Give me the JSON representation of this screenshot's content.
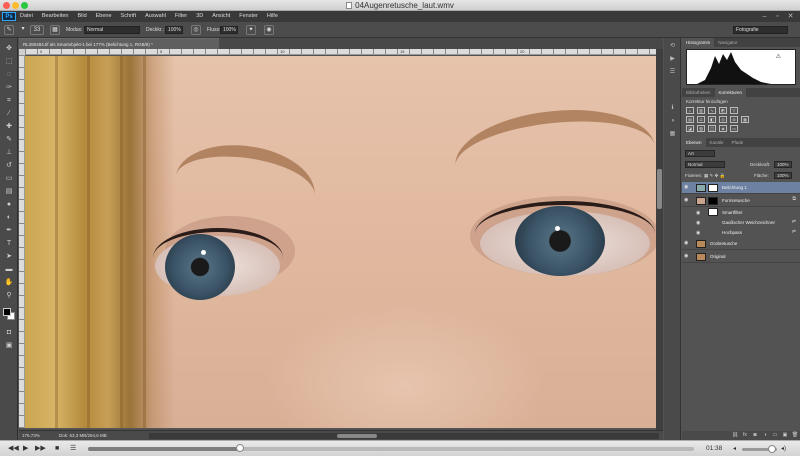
{
  "window": {
    "title": "04Augenretusche_laut.wmv"
  },
  "app": {
    "logo": "Ps",
    "menu": [
      "Datei",
      "Bearbeiten",
      "Bild",
      "Ebene",
      "Schrift",
      "Auswahl",
      "Filter",
      "3D",
      "Ansicht",
      "Fenster",
      "Hilfe"
    ]
  },
  "options": {
    "size": "33",
    "mode_label": "Modus:",
    "mode_value": "Normal",
    "opacity_label": "Deckkr.:",
    "opacity_value": "100%",
    "flow_label": "Fluss:",
    "flow_value": "100%",
    "workspace": "Fotografie"
  },
  "document": {
    "tab": "RL380484.tif als Smartobjekt-1 bei 177% (Belichtung 1, RGB/8) *",
    "ruler_numbers": [
      "0",
      "5",
      "10",
      "15",
      "20"
    ],
    "zoom": "176,73%",
    "doc_info": "Dok: 63,3 MB/294,6 MB"
  },
  "panels": {
    "histogram_tabs": [
      "Histogramm",
      "Navigator"
    ],
    "adjust_tabs": [
      "Bibliotheken",
      "Korrekturen"
    ],
    "adjust_title": "Korrektur hinzufügen",
    "layers_tabs": [
      "Ebenen",
      "Kanäle",
      "Pfade"
    ],
    "kind": "Art",
    "blend": "Normal",
    "opacity_label": "Deckkraft:",
    "opacity_value": "100%",
    "lock_label": "Fixieren:",
    "fill_label": "Fläche:",
    "fill_value": "100%",
    "layers": [
      {
        "name": "Belichtung 1",
        "selected": true
      },
      {
        "name": "Formretusche",
        "selected": false
      },
      {
        "name": "Smartfilter",
        "sub": true
      },
      {
        "name": "Gaußscher Weichzeichner",
        "sub": true
      },
      {
        "name": "Hochpass",
        "sub": true
      },
      {
        "name": "Grobretusche",
        "selected": false
      },
      {
        "name": "Original",
        "selected": false
      }
    ]
  },
  "player": {
    "time": "01:38",
    "progress": 0.25,
    "volume": 0.85
  },
  "colors": {
    "accent": "#6d82a3",
    "ps_blue": "#31a8ff"
  }
}
